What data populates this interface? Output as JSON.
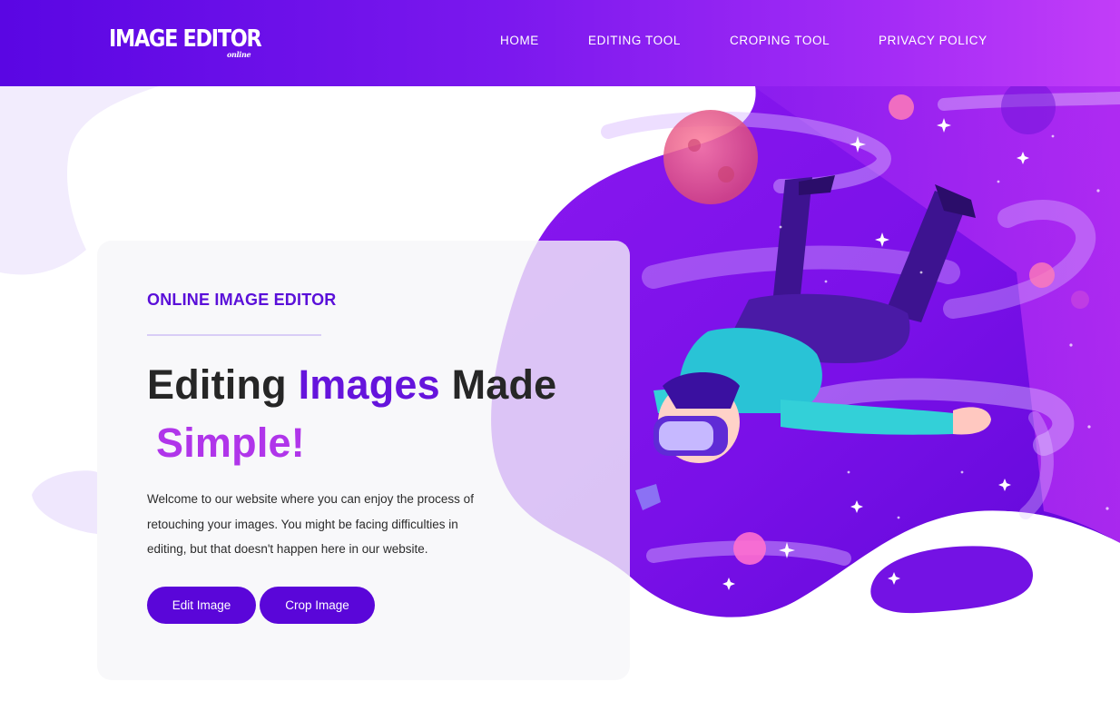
{
  "header": {
    "logo": {
      "main": "IMAGE EDITOR",
      "sub": "online"
    },
    "nav": [
      {
        "label": "HOME"
      },
      {
        "label": "EDITING TOOL"
      },
      {
        "label": "CROPING TOOL"
      },
      {
        "label": "PRIVACY POLICY"
      }
    ]
  },
  "hero": {
    "eyebrow": "ONLINE IMAGE EDITOR",
    "headline": {
      "part1": "Editing ",
      "part2": "Images",
      "part3": " Made",
      "part4": "Simple!"
    },
    "intro": "Welcome to our website where you can enjoy the process of retouching your images. You might be facing difficulties in editing, but that doesn't happen here in our website.",
    "buttons": {
      "edit": "Edit Image",
      "crop": "Crop Image"
    }
  },
  "illustration": {
    "subject": "astronaut-vr-illustration"
  },
  "colors": {
    "header_start": "#5a06e3",
    "header_end": "#c23df8",
    "accent_purple": "#6514dc",
    "accent_magenta": "#b035ea",
    "button": "#5a06d9",
    "text_dark": "#262626"
  }
}
